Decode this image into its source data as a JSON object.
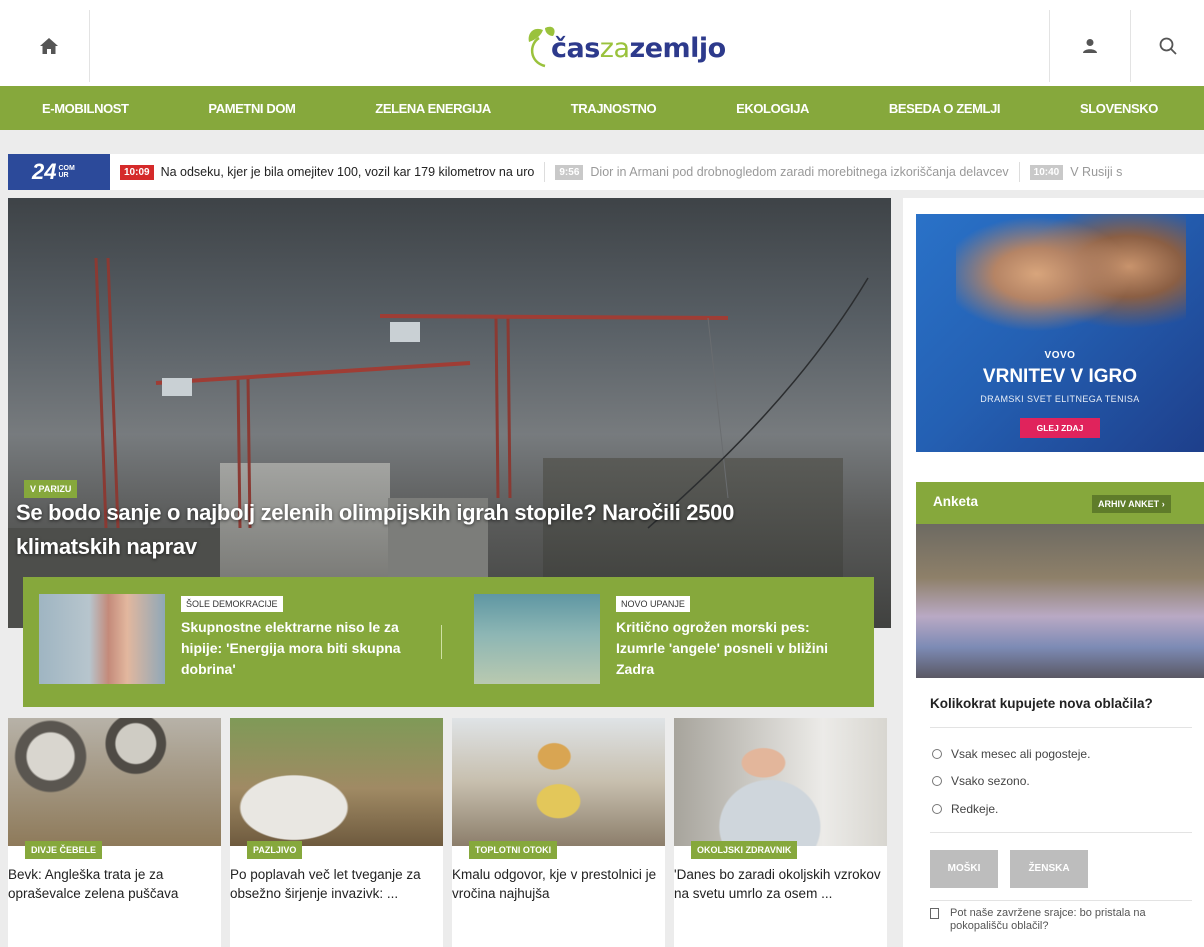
{
  "header": {
    "logo_parts": [
      "čas",
      "za",
      "zemljo"
    ],
    "icons": {
      "home": "home-icon",
      "user": "user-icon",
      "search": "search-icon"
    }
  },
  "nav": [
    "E-MOBILNOST",
    "PAMETNI DOM",
    "ZELENA ENERGIJA",
    "TRAJNOSTNO",
    "EKOLOGIJA",
    "BESEDA O ZEMLJI",
    "SLOVENSKO"
  ],
  "ticker": {
    "logo_main": "24",
    "logo_small_top": "COM",
    "logo_small_bottom": "UR",
    "items": [
      {
        "time": "10:09",
        "text": "Na odseku, kjer je bila omejitev 100, vozil kar 179 kilometrov na uro"
      },
      {
        "time": "9:56",
        "text": "Dior in Armani pod drobnogledom zaradi morebitnega izkoriščanja delavcev"
      },
      {
        "time": "10:40",
        "text": "V Rusiji s"
      }
    ]
  },
  "hero": {
    "kicker": "V PARIZU",
    "title": "Se bodo sanje o najbolj zelenih olimpijskih igrah stopile? Naročili 2500 klimatskih naprav"
  },
  "featured": [
    {
      "label": "ŠOLE DEMOKRACIJE",
      "title": "Skupnostne elektrarne niso le za hipije: 'Energija mora biti skupna dobrina'"
    },
    {
      "label": "NOVO UPANJE",
      "title": "Kritično ogrožen morski pes: Izumrle 'angele' posneli v bližini Zadra"
    }
  ],
  "cards": [
    {
      "kicker": "DIVJE ČEBELE",
      "title": "Bevk: Angleška trata je za opraševalce zelena puščava"
    },
    {
      "kicker": "PAZLJIVO",
      "title": "Po poplavah več let tveganje za obsežno širjenje invazivk: ..."
    },
    {
      "kicker": "TOPLOTNI OTOKI",
      "title": "Kmalu odgovor, kje v prestolnici je vročina najhujša"
    },
    {
      "kicker": "OKOLJSKI ZDRAVNIK",
      "title": "'Danes bo zaradi okoljskih vzrokov na svetu umrlo za osem ..."
    }
  ],
  "ad": {
    "brand": "VOVO",
    "headline": "VRNITEV V IGRO",
    "subline": "DRAMSKI SVET ELITNEGA TENISA",
    "cta": "GLEJ ZDAJ"
  },
  "poll": {
    "title": "Anketa",
    "archive": "ARHIV ANKET",
    "archive_icon": "chevron-right-icon",
    "question": "Kolikokrat kupujete nova oblačila?",
    "options": [
      "Vsak mesec ali pogosteje.",
      "Vsako sezono.",
      "Redkeje."
    ],
    "buttons": [
      "MOŠKI",
      "ŽENSKA"
    ],
    "related": "Pot naše zavržene srajce: bo pristala na pokopališču oblačil?"
  },
  "colors": {
    "brand_green": "#86a83c",
    "brand_blue": "#2d3a8c",
    "ticker_red": "#d52a2a"
  }
}
